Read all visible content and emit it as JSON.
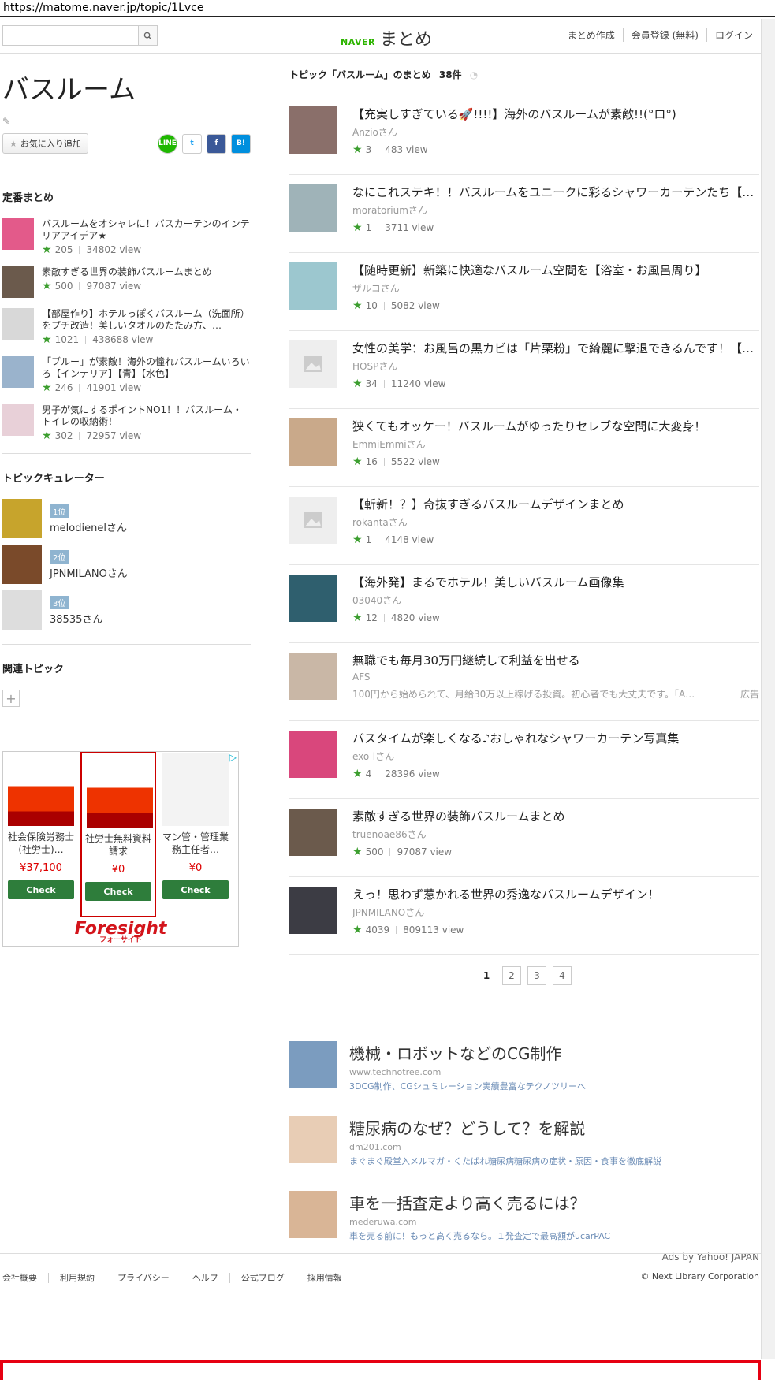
{
  "browser": {
    "url": "https://matome.naver.jp/topic/1Lvce"
  },
  "header": {
    "search_placeholder": "",
    "logo_naver": "NAVER",
    "logo_matome": "まとめ",
    "links": [
      "まとめ作成",
      "会員登録 (無料)",
      "ログイン"
    ]
  },
  "page": {
    "title": "バスルーム",
    "fav_label": "お気に入り追加",
    "social": [
      "LINE",
      "t",
      "f",
      "B!"
    ]
  },
  "standard": {
    "heading": "定番まとめ",
    "items": [
      {
        "title": "バスルームをオシャレに！バスカーテンのインテリアアイデア★",
        "likes": "205",
        "views": "34802",
        "view_label": "view",
        "color": "#e35a8a"
      },
      {
        "title": "素敵すぎる世界の装飾バスルームまとめ",
        "likes": "500",
        "views": "97087",
        "view_label": "view",
        "color": "#6b5a4c"
      },
      {
        "title": "【部屋作り】ホテルっぽくバスルーム（洗面所）をプチ改造！美しいタオルのたたみ方、…",
        "likes": "1021",
        "views": "438688",
        "view_label": "view",
        "color": "#d8d8d8"
      },
      {
        "title": "「ブルー」が素敵！海外の憧れバスルームいろいろ【インテリア】【青】【水色】",
        "likes": "246",
        "views": "41901",
        "view_label": "view",
        "color": "#9ab3cc"
      },
      {
        "title": "男子が気にするポイントNO1！！バスルーム・トイレの収納術！",
        "likes": "302",
        "views": "72957",
        "view_label": "view",
        "color": "#e8d0d8"
      }
    ]
  },
  "curators": {
    "heading": "トピックキュレーター",
    "items": [
      {
        "rank": "1位",
        "name": "melodienelさん",
        "color": "#c7a42c"
      },
      {
        "rank": "2位",
        "name": "JPNMILANOさん",
        "color": "#7a4a2a"
      },
      {
        "rank": "3位",
        "name": "38535さん",
        "color": "#dddddd"
      }
    ]
  },
  "related": {
    "heading": "関連トピック",
    "plus": "+"
  },
  "ad": {
    "cells": [
      {
        "name": "社会保険労務士(社労士)…",
        "price": "¥37,100",
        "check": "Check"
      },
      {
        "name": "社労士無料資料請求",
        "price": "¥0",
        "check": "Check"
      },
      {
        "name": "マン管・管理業務主任者…",
        "price": "¥0",
        "check": "Check"
      }
    ],
    "brand": "Foresight",
    "brand_sub": "フォーサイト",
    "info_icon": "▷"
  },
  "main": {
    "heading": "トピック「バスルーム」のまとめ",
    "count": "38件",
    "items": [
      {
        "title": "【充実しすぎている🚀!!!!】海外のバスルームが素敵!!(°ロ°)",
        "author": "Anzioさん",
        "likes": "3",
        "views": "483",
        "view_label": "view",
        "color": "#8a6f6a"
      },
      {
        "title": "なにこれステキ！！バスルームをユニークに彩るシャワーカーテンたち【…",
        "author": "moratoriumさん",
        "likes": "1",
        "views": "3711",
        "view_label": "view",
        "color": "#9fb3b8"
      },
      {
        "title": "【随時更新】新築に快適なバスルーム空間を【浴室・お風呂周り】",
        "author": "ザルコさん",
        "likes": "10",
        "views": "5082",
        "view_label": "view",
        "color": "#9cc7cf"
      },
      {
        "title": "女性の美学：お風呂の黒カビは「片栗粉」で綺麗に撃退できるんです！【…",
        "author": "HOSPさん",
        "likes": "34",
        "views": "11240",
        "view_label": "view",
        "color": "#eeeeee"
      },
      {
        "title": "狭くてもオッケー！バスルームがゆったりセレブな空間に大変身！",
        "author": "EmmiEmmiさん",
        "likes": "16",
        "views": "5522",
        "view_label": "view",
        "color": "#c9a98a"
      },
      {
        "title": "【斬新！？】奇抜すぎるバスルームデザインまとめ",
        "author": "rokantaさん",
        "likes": "1",
        "views": "4148",
        "view_label": "view",
        "color": "#eeeeee"
      },
      {
        "title": "【海外発】まるでホテル！美しいバスルーム画像集",
        "author": "03040さん",
        "likes": "12",
        "views": "4820",
        "view_label": "view",
        "color": "#2f5f6e"
      }
    ],
    "ad_item": {
      "title": "無職でも毎月30万円継続して利益を出せる",
      "author": "AFS",
      "desc": "100円から始められて、月給30万以上稼げる投資。初心者でも大丈夫です。「A…",
      "badge": "広告",
      "color": "#c9b7a6"
    },
    "items2": [
      {
        "title": "バスタイムが楽しくなる♪おしゃれなシャワーカーテン写真集",
        "author": "exo-lさん",
        "likes": "4",
        "views": "28396",
        "view_label": "view",
        "color": "#d9477c"
      },
      {
        "title": "素敵すぎる世界の装飾バスルームまとめ",
        "author": "truenoae86さん",
        "likes": "500",
        "views": "97087",
        "view_label": "view",
        "color": "#6b5a4c"
      },
      {
        "title": "えっ！思わず惹かれる世界の秀逸なバスルームデザイン！",
        "author": "JPNMILANOさん",
        "likes": "4039",
        "views": "809113",
        "view_label": "view",
        "color": "#3c3c44"
      }
    ],
    "pages": [
      "1",
      "2",
      "3",
      "4"
    ]
  },
  "yahoo": {
    "items": [
      {
        "title": "機械・ロボットなどのCG制作",
        "url": "www.technotree.com",
        "desc": "3DCG制作、CGシュミレーション実績豊富なテクノツリーへ",
        "color": "#7b9cbf"
      },
      {
        "title": "糖尿病のなぜ？どうして？を解説",
        "url": "dm201.com",
        "desc": "まぐまぐ殿堂入メルマガ・くたばれ糖尿病糖尿病の症状・原因・食事を徹底解説",
        "color": "#e8cdb5"
      },
      {
        "title": "車を一括査定より高く売るには？",
        "url": "mederuwa.com",
        "desc": "車を売る前に！もっと高く売るなら。１発査定で最高額がucarPAC",
        "color": "#d9b596"
      }
    ],
    "credit": "Ads by Yahoo! JAPAN"
  },
  "footer": {
    "links": [
      "会社概要",
      "利用規約",
      "プライバシー",
      "ヘルプ",
      "公式ブログ",
      "採用情報"
    ],
    "copyright": "© Next Library Corporation"
  }
}
